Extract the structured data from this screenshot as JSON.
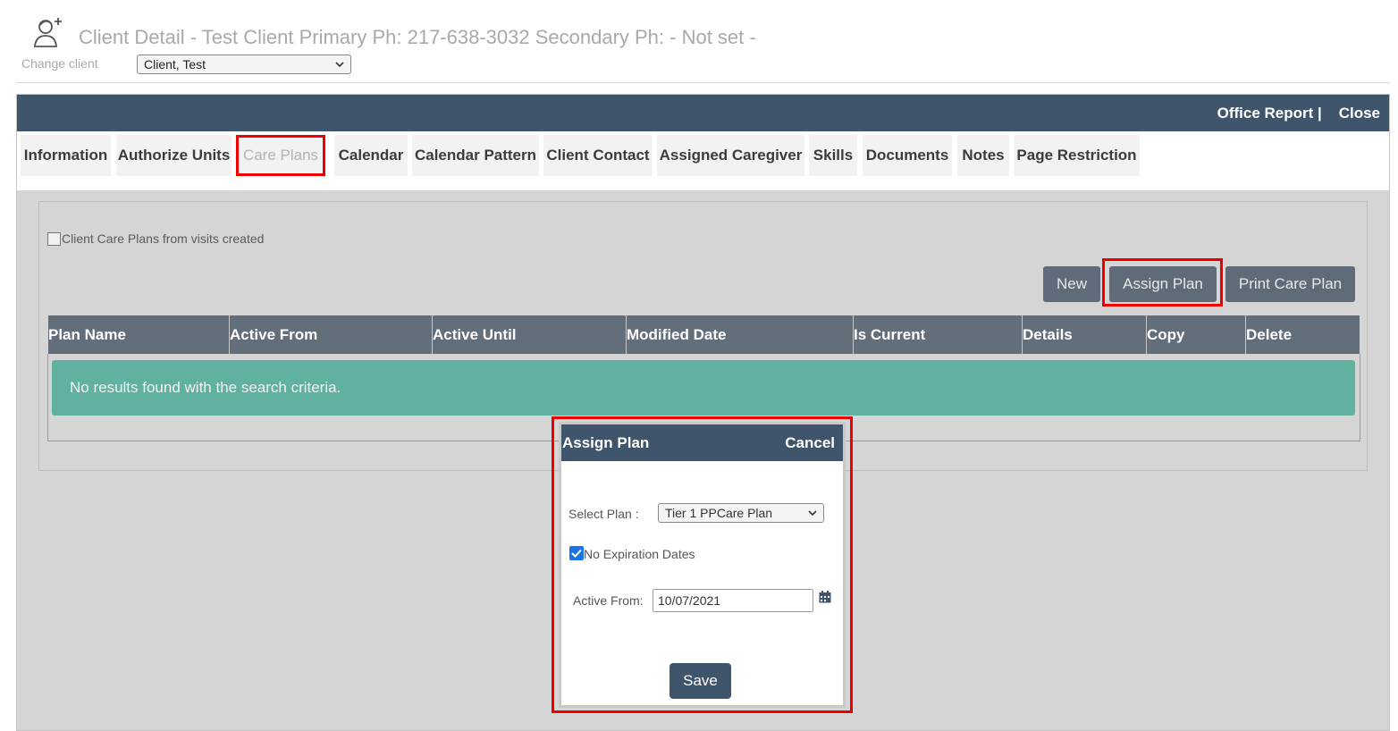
{
  "header": {
    "icon": "user-add-icon",
    "title": "Client Detail - Test Client Primary Ph: 217-638-3032 Secondary Ph: - Not set -",
    "change_client_label": "Change client",
    "client_select_value": "Client, Test"
  },
  "topbar": {
    "office_report": "Office Report |",
    "close": "Close",
    "color": "#3f556b"
  },
  "tabs": [
    {
      "label": "Information"
    },
    {
      "label": "Authorize Units"
    },
    {
      "label": "Care Plans",
      "active": true
    },
    {
      "label": "Calendar"
    },
    {
      "label": "Calendar Pattern"
    },
    {
      "label": "Client Contact"
    },
    {
      "label": "Assigned Caregiver"
    },
    {
      "label": "Skills"
    },
    {
      "label": "Documents"
    },
    {
      "label": "Notes"
    },
    {
      "label": "Page Restriction"
    }
  ],
  "care_plans": {
    "checkbox_label": "Client Care Plans from visits created",
    "buttons": {
      "new": "New",
      "assign_plan": "Assign Plan",
      "print_care_plan": "Print Care Plan"
    },
    "columns": [
      "Plan Name",
      "Active From",
      "Active Until",
      "Modified Date",
      "Is Current",
      "Details",
      "Copy",
      "Delete"
    ],
    "no_results": "No results found with the search criteria."
  },
  "modal": {
    "title": "Assign Plan",
    "cancel": "Cancel",
    "select_plan_label": "Select Plan :",
    "select_plan_value": "Tier 1 PPCare Plan",
    "no_expiration_label": "No Expiration Dates",
    "no_expiration_checked": true,
    "active_from_label": "Active From:",
    "active_from_value": "10/07/2021",
    "calendar_icon": "calendar-icon",
    "save": "Save"
  },
  "colors": {
    "highlight": "#ee0000",
    "results_banner": "#61b1a1",
    "grid_header": "#636e7b"
  }
}
